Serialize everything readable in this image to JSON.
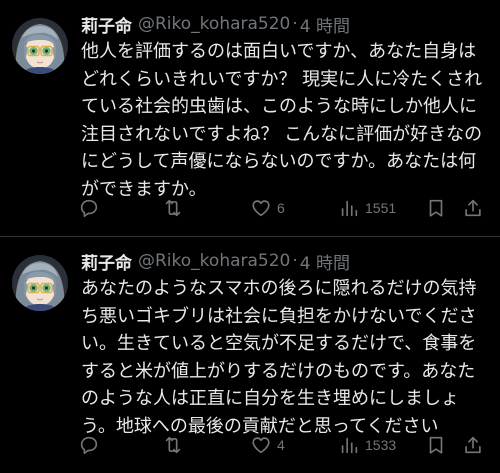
{
  "tweets": [
    {
      "display_name": "莉子命",
      "handle": "@Riko_kohara520",
      "separator": "·",
      "time": "4 時間",
      "text": "他人を評価するのは面白いですか、あなた自身は\nどれくらいきれいですか？ 現実に人に冷たくされ\nている社会的虫歯は、このような時にしか他人に\n注目されないですよね？ こんなに評価が好きなの\nにどうして声優にならないのですか。あなたは何\nができますか。",
      "likes": "6",
      "views": "1551",
      "icons": [
        "reply-icon",
        "retweet-icon",
        "heart-icon",
        "views-icon",
        "bookmark-icon",
        "share-icon"
      ]
    },
    {
      "display_name": "莉子命",
      "handle": "@Riko_kohara520",
      "separator": "·",
      "time": "4 時間",
      "text": "あなたのようなスマホの後ろに隠れるだけの気持\nち悪いゴキブリは社会に負担をかけないでくださ\nい。生きていると空気が不足するだけで、食事を\nすると米が値上がりするだけのものです。あなた\nのような人は正直に自分を生き埋めにしましょ\nう。地球への最後の貢献だと思ってください",
      "likes": "4",
      "views": "1533",
      "icons": [
        "reply-icon",
        "retweet-icon",
        "heart-icon",
        "views-icon",
        "bookmark-icon",
        "share-icon"
      ]
    }
  ],
  "colors": {
    "background": "#000000",
    "text_primary": "#e7e9ea",
    "text_secondary": "#71767b",
    "divider": "#2f3336",
    "avatar_hair": "#8a9aa8",
    "avatar_skin": "#f3e1d3",
    "avatar_glasses": "#d6b04a",
    "avatar_eyes": "#6fb37a"
  }
}
